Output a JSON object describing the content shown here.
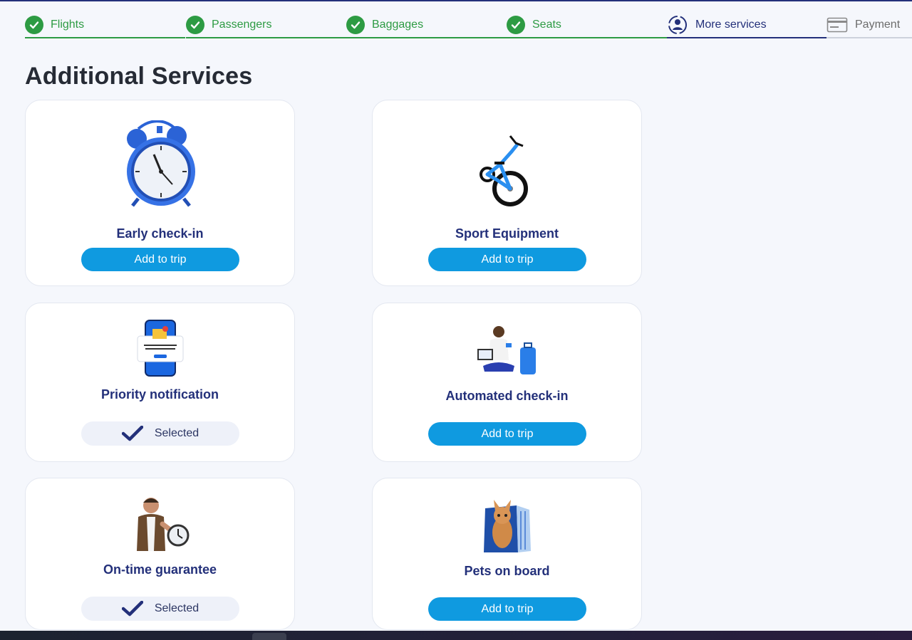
{
  "stepper": {
    "steps": [
      {
        "label": "Flights",
        "state": "done"
      },
      {
        "label": "Passengers",
        "state": "done"
      },
      {
        "label": "Baggages",
        "state": "done"
      },
      {
        "label": "Seats",
        "state": "done"
      },
      {
        "label": "More services",
        "state": "active"
      },
      {
        "label": "Payment",
        "state": "pending"
      }
    ]
  },
  "page": {
    "title": "Additional Services"
  },
  "services": [
    {
      "name": "Early check-in",
      "status": "available",
      "action_label": "Add to trip",
      "icon": "alarm-clock-icon"
    },
    {
      "name": "Sport Equipment",
      "status": "available",
      "action_label": "Add to trip",
      "icon": "bicycle-icon"
    },
    {
      "name": "Priority notification",
      "status": "selected",
      "action_label": "Selected",
      "icon": "phone-notification-icon"
    },
    {
      "name": "Automated check-in",
      "status": "available",
      "action_label": "Add to trip",
      "icon": "traveler-laptop-icon"
    },
    {
      "name": "On-time guarantee",
      "status": "selected",
      "action_label": "Selected",
      "icon": "man-with-clock-icon"
    },
    {
      "name": "Pets on board",
      "status": "available",
      "action_label": "Add to trip",
      "icon": "cat-carrier-icon"
    }
  ],
  "colors": {
    "done": "#2d9b43",
    "active": "#23307a",
    "pending": "#6c6c6c",
    "button": "#0f9ae0",
    "card_title": "#23307a",
    "background": "#f5f7fc"
  }
}
